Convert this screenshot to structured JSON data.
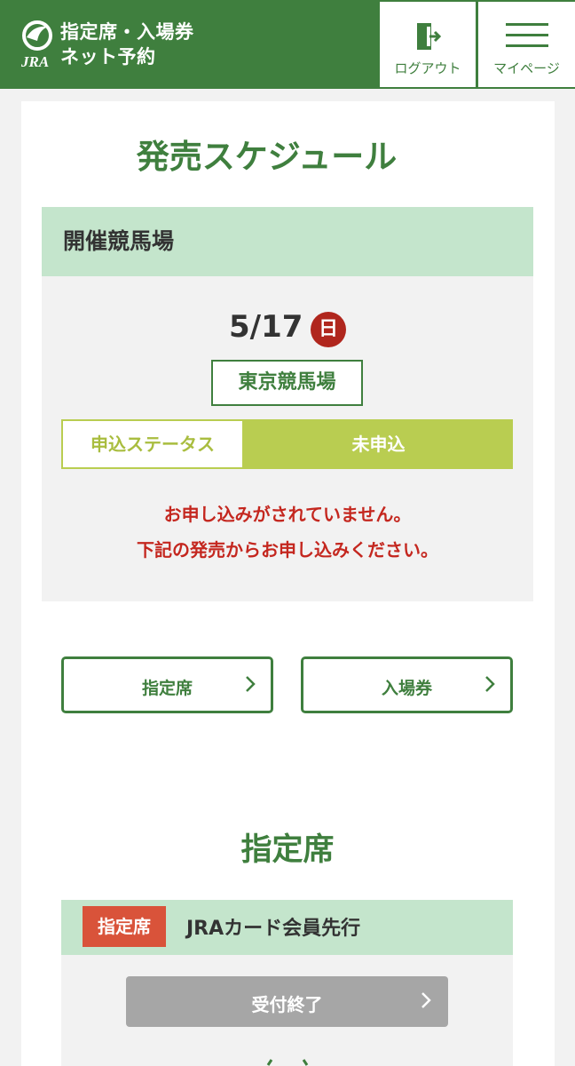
{
  "header": {
    "logo_text": "JRA",
    "brand_line1": "指定席・入場券",
    "brand_line2": "ネット予約",
    "logout_label": "ログアウト",
    "mypage_label": "マイページ"
  },
  "page": {
    "title": "発売スケジュール"
  },
  "venue": {
    "heading": "開催競馬場",
    "date": "5/17",
    "day": "日",
    "course": "東京競馬場",
    "status_label": "申込ステータス",
    "status_value": "未申込",
    "message_line1": "お申し込みがされていません。",
    "message_line2": "下記の発売からお申し込みください。"
  },
  "select_buttons": {
    "seat": "指定席",
    "entry": "入場券"
  },
  "seat_section": {
    "title": "指定席",
    "tag": "指定席",
    "sale_name": "JRAカード会員先行",
    "closed_label": "受付終了"
  },
  "colors": {
    "brand_green": "#3f7f3e",
    "light_green": "#c4e5cc",
    "lime": "#b9cd51",
    "alert_red": "#c4271f",
    "tag_orange": "#d9533a",
    "disabled_gray": "#a6a6a6"
  },
  "icons": {
    "logout": "logout-door-icon",
    "mypage": "hamburger-menu-icon",
    "chevron": "chevron-right-icon"
  }
}
